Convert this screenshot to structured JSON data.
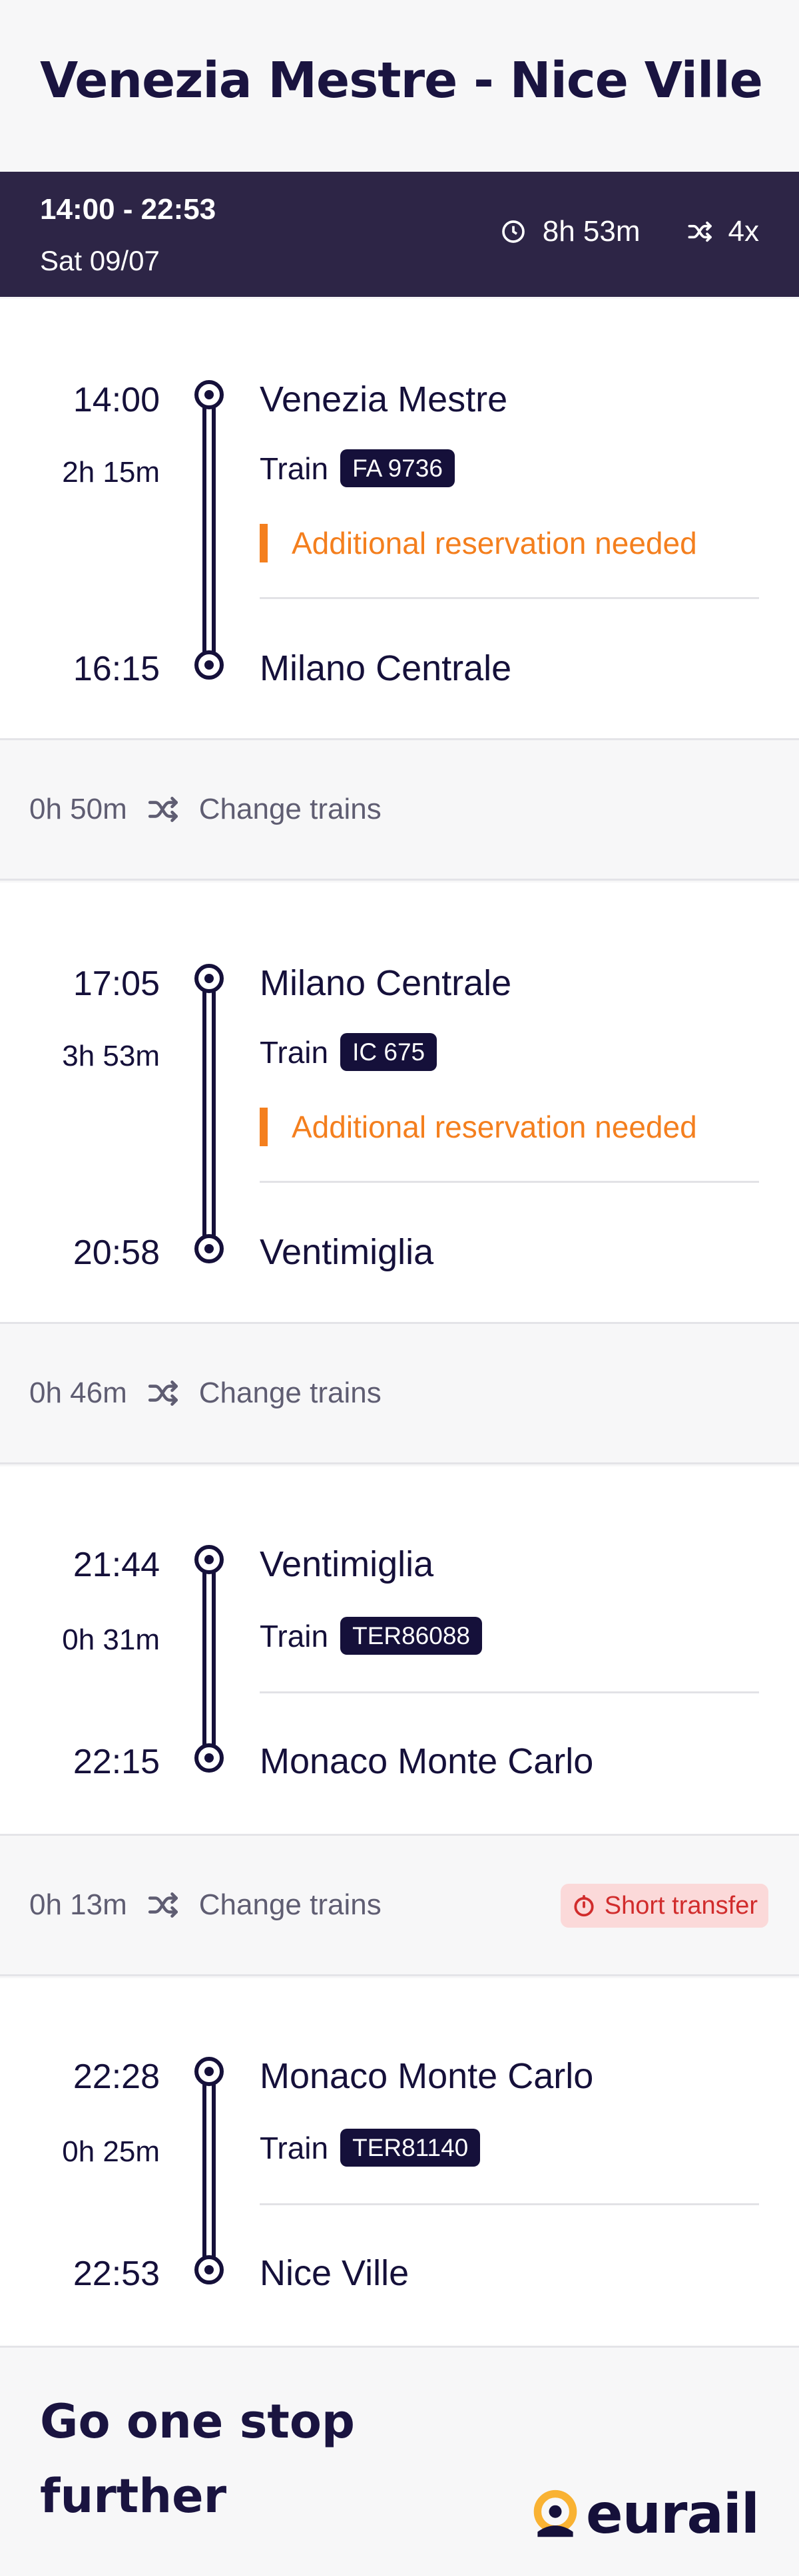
{
  "route": {
    "title": "Venezia Mestre - Nice Ville"
  },
  "summary": {
    "times": "14:00 - 22:53",
    "date": "Sat 09/07",
    "duration": "8h 53m",
    "transfers": "4x"
  },
  "legs": [
    {
      "dep_time": "14:00",
      "dep_station": "Venezia Mestre",
      "duration": "2h 15m",
      "train_label": "Train",
      "train_number": "FA 9736",
      "reservation_note": "Additional reservation needed",
      "arr_time": "16:15",
      "arr_station": "Milano Centrale"
    },
    {
      "dep_time": "17:05",
      "dep_station": "Milano Centrale",
      "duration": "3h 53m",
      "train_label": "Train",
      "train_number": "IC 675",
      "reservation_note": "Additional reservation needed",
      "arr_time": "20:58",
      "arr_station": "Ventimiglia"
    },
    {
      "dep_time": "21:44",
      "dep_station": "Ventimiglia",
      "duration": "0h 31m",
      "train_label": "Train",
      "train_number": "TER86088",
      "arr_time": "22:15",
      "arr_station": "Monaco Monte Carlo"
    },
    {
      "dep_time": "22:28",
      "dep_station": "Monaco Monte Carlo",
      "duration": "0h 25m",
      "train_label": "Train",
      "train_number": "TER81140",
      "arr_time": "22:53",
      "arr_station": "Nice Ville"
    }
  ],
  "transfers": [
    {
      "duration": "0h 50m",
      "label": "Change trains"
    },
    {
      "duration": "0h 46m",
      "label": "Change trains"
    },
    {
      "duration": "0h 13m",
      "label": "Change trains",
      "warning": "Short transfer"
    }
  ],
  "footer": {
    "title": "Go one stop further",
    "brand": "eurail"
  },
  "colors": {
    "navy": "#15103a",
    "summary_bg": "#2d2546",
    "warning_orange": "#f47f1e",
    "short_transfer_red": "#d12c2c",
    "brand_yellow": "#f9b233"
  },
  "icons": {
    "duration": "clock-icon",
    "transfer": "shuffle-icon",
    "short_transfer": "timer-icon",
    "brand": "eurail-logo-icon"
  }
}
